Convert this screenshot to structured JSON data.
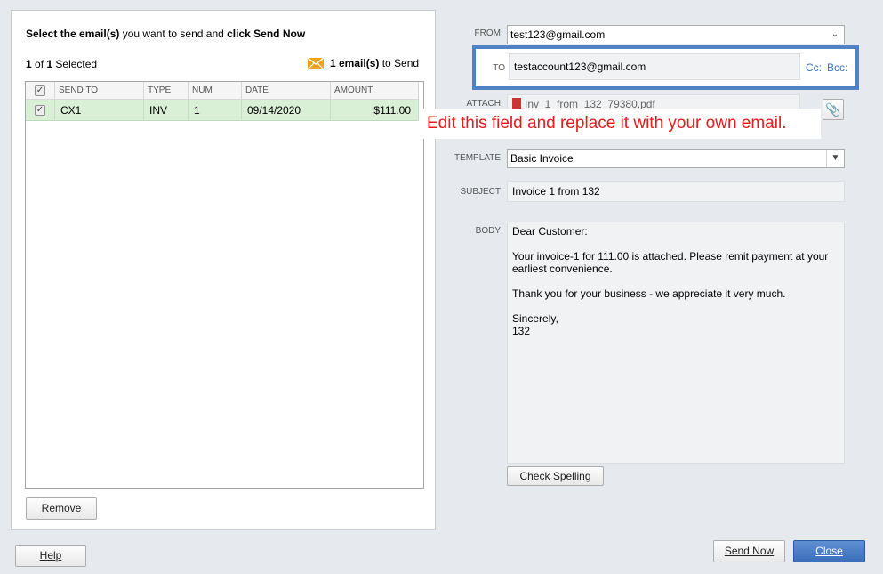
{
  "left_panel": {
    "instruction": {
      "p1": "Select the email(s)",
      "p2": " you want to send and ",
      "p3": "click Send Now"
    },
    "selected": {
      "n": "1",
      "of": " of ",
      "total": "1",
      "suffix": " Selected"
    },
    "send_count": {
      "n": "1 email(s)",
      "suffix": " to Send"
    },
    "table": {
      "headers": [
        "SEND TO",
        "TYPE",
        "NUM",
        "DATE",
        "AMOUNT"
      ],
      "rows": [
        {
          "send_to": "CX1",
          "type": "INV",
          "num": "1",
          "date": "09/14/2020",
          "amount": "$111.00",
          "checked": true
        }
      ]
    },
    "remove_label": "Remove"
  },
  "form": {
    "from_label": "FROM",
    "from_value": "test123@gmail.com",
    "to_label": "TO",
    "to_value": "testaccount123@gmail.com",
    "cc_label": "Cc:",
    "bcc_label": "Bcc:",
    "attach_label": "ATTACH",
    "attach_file": "Inv_1_from_132_79380.pdf",
    "template_label": "TEMPLATE",
    "template_value": "Basic Invoice",
    "subject_label": "SUBJECT",
    "subject_value": "Invoice 1 from 132",
    "body_label": "BODY",
    "body_lines": [
      "Dear Customer:",
      "",
      "Your invoice-1 for 111.00 is attached. Please remit payment at your",
      "earliest convenience.",
      "",
      "Thank you for your business - we appreciate it very much.",
      "",
      "Sincerely,",
      "132"
    ],
    "check_spelling_label": "Check Spelling"
  },
  "annotation": "Edit this field and replace it with your own email.",
  "footer": {
    "help_label": "Help",
    "send_now_label": "Send Now",
    "close_label": "Close"
  },
  "colors": {
    "highlight": "#4f83c4",
    "annotation_text": "#e31b1b",
    "selected_row": "#d9efd6",
    "close_button": "#3a6fba",
    "envelope": "#f0a020"
  }
}
